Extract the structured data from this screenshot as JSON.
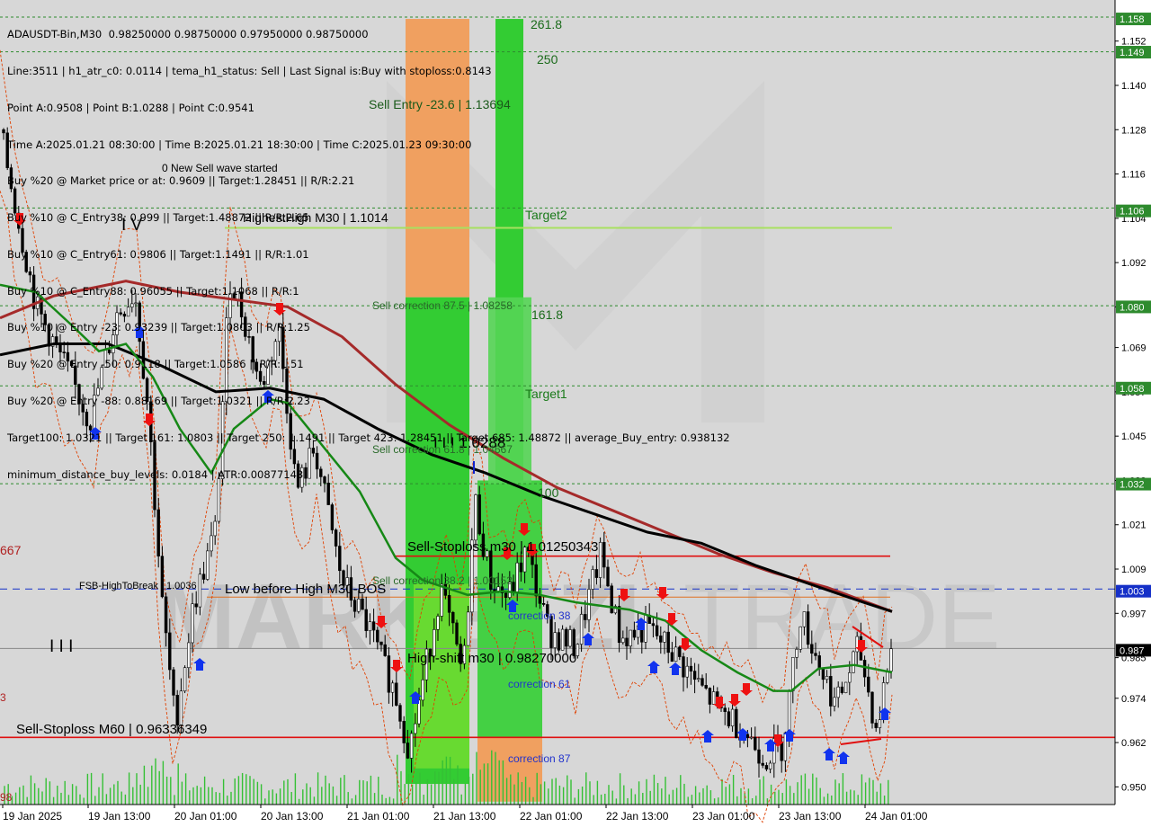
{
  "symbol_header": "ADAUSDT-Bin,M30  0.98250000 0.98750000 0.97950000 0.98750000",
  "info_lines": [
    "Line:3511 | h1_atr_c0: 0.0114 | tema_h1_status: Sell | Last Signal is:Buy with stoploss:0.8143",
    "Point A:0.9508 | Point B:1.0288 | Point C:0.9541",
    "Time A:2025.01.21 08:30:00 | Time B:2025.01.21 18:30:00 | Time C:2025.01.23 09:30:00",
    "Buy %20 @ Market price or at: 0.9609 || Target:1.28451 || R/R:2.21",
    "Buy %10 @ C_Entry38: 0.999 || Target:1.48872 || R/R:2.65",
    "Buy %10 @ C_Entry61: 0.9806 || Target:1.1491 || R/R:1.01",
    "Buy %10 @ C_Entry88: 0.96055 || Target:1.1068 || R/R:1",
    "Buy %10 @ Entry -23: 0.93239 || Target:1.0803 || R/R:1.25",
    "Buy %20 @ Entry -50: 0.9118 || Target:1.0586 || R/R:1.51",
    "Buy %20 @ Entry -88: 0.88169 || Target:1.0321 || R/R:2.23",
    "Target100: 1.0321 || Target 161: 1.0803 || Target 250: 1.1491 || Target 423: 1.28451 || Target 685: 1.48872 || average_Buy_entry: 0.938132",
    "minimum_distance_buy_levels: 0.0184 | ATR:0.00877143"
  ],
  "annotations": {
    "new_wave": "0 New Sell wave started",
    "wave_iv": "I V",
    "wave_iii_left": "I I I",
    "wave_iii_peak": "I I I 1.0288",
    "highest_high": "HighestHigh   M30 | 1.1014",
    "sell_entry": "Sell Entry -23.6 | 1.13694",
    "fib_2618": "261.8",
    "fib_250": "250",
    "fib_1618": "161.8",
    "target2": "Target2",
    "target1": "Target1",
    "sell_corr_875": "Sell correction 87.5 | 1.08258",
    "sell_corr_618": "Sell correction 61.8 | 1.04667",
    "sell_corr_382": "Sell correction 38.2 | 1.00153",
    "fib_100": "100",
    "sell_stoploss_m30": "Sell-Stoploss m30 | 1.01250343",
    "fsb": "FSB-HighToBreak | 1.0036",
    "low_before_high": "Low before High   M30-BOS",
    "high_shift": "High-shift m30 | 0.98270000",
    "correction_38": "correction 38",
    "correction_61": "correction 61",
    "correction_87": "correction 87",
    "sell_stoploss_m60": "Sell-Stoploss M60 | 0.96336349",
    "left_edge_top": "667",
    "left_edge_bottom": "98",
    "left_edge_mid": "3",
    "watermark_left": "MARKETZI",
    "watermark_right": "TRADE"
  },
  "price_scale": {
    "labels": [
      "1.152",
      "1.140",
      "1.128",
      "1.116",
      "1.104",
      "1.092",
      "1.080",
      "1.069",
      "1.057",
      "1.045",
      "1.033",
      "1.021",
      "1.009",
      "0.997",
      "0.985",
      "0.974",
      "0.962",
      "0.950"
    ],
    "badges": [
      {
        "text": "1.158",
        "color": "#2e8b2e"
      },
      {
        "text": "1.149",
        "color": "#2e8b2e"
      },
      {
        "text": "1.106",
        "color": "#2e8b2e"
      },
      {
        "text": "1.080",
        "color": "#2e8b2e"
      },
      {
        "text": "1.058",
        "color": "#2e8b2e"
      },
      {
        "text": "1.032",
        "color": "#2e8b2e"
      },
      {
        "text": "1.003",
        "color": "#1530c8"
      },
      {
        "text": "0.987",
        "color": "#000000"
      }
    ]
  },
  "time_scale": {
    "labels": [
      "19 Jan 2025",
      "19 Jan 13:00",
      "20 Jan 01:00",
      "20 Jan 13:00",
      "21 Jan 01:00",
      "21 Jan 13:00",
      "22 Jan 01:00",
      "22 Jan 13:00",
      "23 Jan 01:00",
      "23 Jan 13:00",
      "24 Jan 01:00"
    ]
  },
  "chart_data": {
    "type": "candlestick",
    "symbol": "ADAUSDT-Bin",
    "timeframe": "M30",
    "ylim": [
      0.945,
      1.158
    ],
    "current_price": 0.9875,
    "levels": [
      {
        "value": 1.1585,
        "color": "#2e8b2e"
      },
      {
        "value": 1.1491,
        "color": "#2e8b2e"
      },
      {
        "value": 1.1068,
        "color": "#2e8b2e"
      },
      {
        "value": 1.0803,
        "color": "#2e8b2e"
      },
      {
        "value": 1.0586,
        "color": "#2e8b2e"
      },
      {
        "value": 1.0321,
        "color": "#2e8b2e"
      },
      {
        "value": 1.0036,
        "color": "#1530c8"
      },
      {
        "value": 0.9875,
        "color": "#888888"
      },
      {
        "value": 1.0125,
        "color": "#e01010"
      },
      {
        "value": 0.9634,
        "color": "#e01010"
      },
      {
        "value": 1.0014,
        "color": "#e07020"
      },
      {
        "value": 1.1014,
        "color": "#a8e060"
      }
    ],
    "zones": [
      {
        "name": "orange",
        "from": 1.0826,
        "to": 1.158,
        "color": "#f0a060"
      },
      {
        "name": "green-a",
        "from": 0.9508,
        "to": 1.0826,
        "color": "#33cc33"
      },
      {
        "name": "green-b",
        "from": 0.95,
        "to": 1.158,
        "color": "#33cc33"
      },
      {
        "name": "green-c",
        "from": 0.9634,
        "to": 1.033,
        "color": "#44d044"
      },
      {
        "name": "orange-low",
        "from": 0.946,
        "to": 0.9634,
        "color": "#f0a060"
      }
    ],
    "close_path": [
      [
        0,
        1.128
      ],
      [
        40,
        1.08
      ],
      [
        80,
        1.06
      ],
      [
        100,
        1.049
      ],
      [
        130,
        1.078
      ],
      [
        150,
        1.084
      ],
      [
        165,
        1.052
      ],
      [
        180,
        1.0
      ],
      [
        195,
        0.967
      ],
      [
        215,
        0.999
      ],
      [
        240,
        1.02
      ],
      [
        255,
        1.088
      ],
      [
        270,
        1.078
      ],
      [
        290,
        1.058
      ],
      [
        310,
        1.074
      ],
      [
        330,
        1.03
      ],
      [
        350,
        1.042
      ],
      [
        380,
        1.006
      ],
      [
        410,
        0.993
      ],
      [
        440,
        0.975
      ],
      [
        455,
        0.96
      ],
      [
        470,
        0.978
      ],
      [
        490,
        1.004
      ],
      [
        515,
        0.98
      ],
      [
        528,
        1.028
      ],
      [
        545,
        1.006
      ],
      [
        565,
        1.001
      ],
      [
        585,
        1.014
      ],
      [
        610,
        0.992
      ],
      [
        640,
        0.988
      ],
      [
        668,
        1.013
      ],
      [
        690,
        0.99
      ],
      [
        720,
        0.993
      ],
      [
        750,
        0.986
      ],
      [
        775,
        0.978
      ],
      [
        800,
        0.971
      ],
      [
        825,
        0.966
      ],
      [
        850,
        0.958
      ],
      [
        870,
        0.961
      ],
      [
        890,
        0.997
      ],
      [
        910,
        0.984
      ],
      [
        930,
        0.972
      ],
      [
        955,
        0.988
      ],
      [
        975,
        0.965
      ],
      [
        990,
        0.9875
      ]
    ],
    "ma_black": [
      [
        0,
        1.067
      ],
      [
        60,
        1.07
      ],
      [
        120,
        1.07
      ],
      [
        180,
        1.064
      ],
      [
        240,
        1.057
      ],
      [
        300,
        1.058
      ],
      [
        360,
        1.055
      ],
      [
        420,
        1.047
      ],
      [
        480,
        1.04
      ],
      [
        540,
        1.035
      ],
      [
        600,
        1.029
      ],
      [
        660,
        1.024
      ],
      [
        720,
        1.019
      ],
      [
        780,
        1.016
      ],
      [
        840,
        1.01
      ],
      [
        900,
        1.005
      ],
      [
        960,
        1.0
      ],
      [
        992,
        0.9975
      ]
    ],
    "ma_red": [
      [
        0,
        1.077
      ],
      [
        60,
        1.083
      ],
      [
        140,
        1.087
      ],
      [
        200,
        1.084
      ],
      [
        260,
        1.082
      ],
      [
        320,
        1.08
      ],
      [
        380,
        1.072
      ],
      [
        440,
        1.059
      ],
      [
        500,
        1.048
      ],
      [
        560,
        1.039
      ],
      [
        620,
        1.031
      ],
      [
        680,
        1.025
      ],
      [
        740,
        1.019
      ],
      [
        800,
        1.013
      ],
      [
        860,
        1.008
      ],
      [
        920,
        1.004
      ],
      [
        992,
        0.9975
      ]
    ],
    "ma_green": [
      [
        0,
        1.086
      ],
      [
        40,
        1.084
      ],
      [
        80,
        1.075
      ],
      [
        110,
        1.068
      ],
      [
        140,
        1.07
      ],
      [
        170,
        1.061
      ],
      [
        200,
        1.047
      ],
      [
        235,
        1.035
      ],
      [
        260,
        1.047
      ],
      [
        300,
        1.055
      ],
      [
        320,
        1.054
      ],
      [
        350,
        1.045
      ],
      [
        400,
        1.03
      ],
      [
        440,
        1.012
      ],
      [
        470,
        1.006
      ],
      [
        520,
        1.002
      ],
      [
        560,
        1.003
      ],
      [
        600,
        1.002
      ],
      [
        640,
        1.0
      ],
      [
        700,
        0.998
      ],
      [
        740,
        0.995
      ],
      [
        780,
        0.987
      ],
      [
        820,
        0.981
      ],
      [
        860,
        0.976
      ],
      [
        880,
        0.976
      ],
      [
        910,
        0.982
      ],
      [
        950,
        0.983
      ],
      [
        992,
        0.981
      ]
    ]
  }
}
